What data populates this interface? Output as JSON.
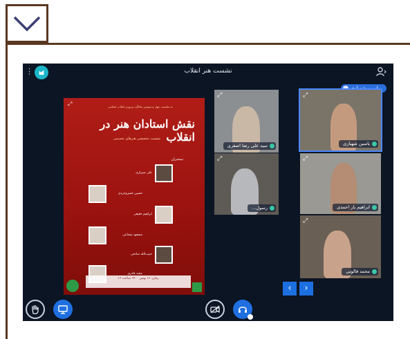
{
  "window": {
    "title": "نشست هنر انقلاب"
  },
  "poster": {
    "header_text": "به مناسبت چهل و سومین سالگرد پیروزی انقلاب اسلامی",
    "title": "نقش استادان هنر در انقلاب",
    "subtitle": "نشست تخصصی هنرهای تجسمی",
    "section_label": "سخنران:",
    "speakers": [
      {
        "name": "علی شیرازی"
      },
      {
        "name": "حسین خسروجردی"
      },
      {
        "name": "ابراهیم حقیقی"
      },
      {
        "name": "مسعود شجاعی"
      },
      {
        "name": "حبیب‌الله صادقی"
      },
      {
        "name": "مجید قادری"
      }
    ],
    "footer_text": "زمان: ۱۶ بهمن ۱۴۰۰ ساعت ۱۶"
  },
  "participants": [
    {
      "name": "سید علی رضا اصغری",
      "active": false
    },
    {
      "name": "یاسین شهبازی",
      "active": true
    },
    {
      "name": "...رسول",
      "active": false
    },
    {
      "name": "ابراهیم یار احمدی",
      "active": false
    },
    {
      "name": "محمد قالونی",
      "active": false
    }
  ],
  "active_speaker": "یاسین شهبازی",
  "controls": {
    "nav_prev": "‹",
    "nav_next": "›"
  },
  "icons": {
    "toggle": "chevron-down-icon",
    "app_logo": "app-logo-icon",
    "user": "user-icon",
    "raise_hand": "hand-icon",
    "screen_share": "monitor-icon",
    "camera": "video-camera-icon",
    "audio": "headphones-icon"
  },
  "colors": {
    "frame": "#5a3722",
    "screen_bg": "#0c1524",
    "accent_blue": "#1f6fe0",
    "logo_teal": "#1cb5c8",
    "poster_red": "#b01d17"
  }
}
